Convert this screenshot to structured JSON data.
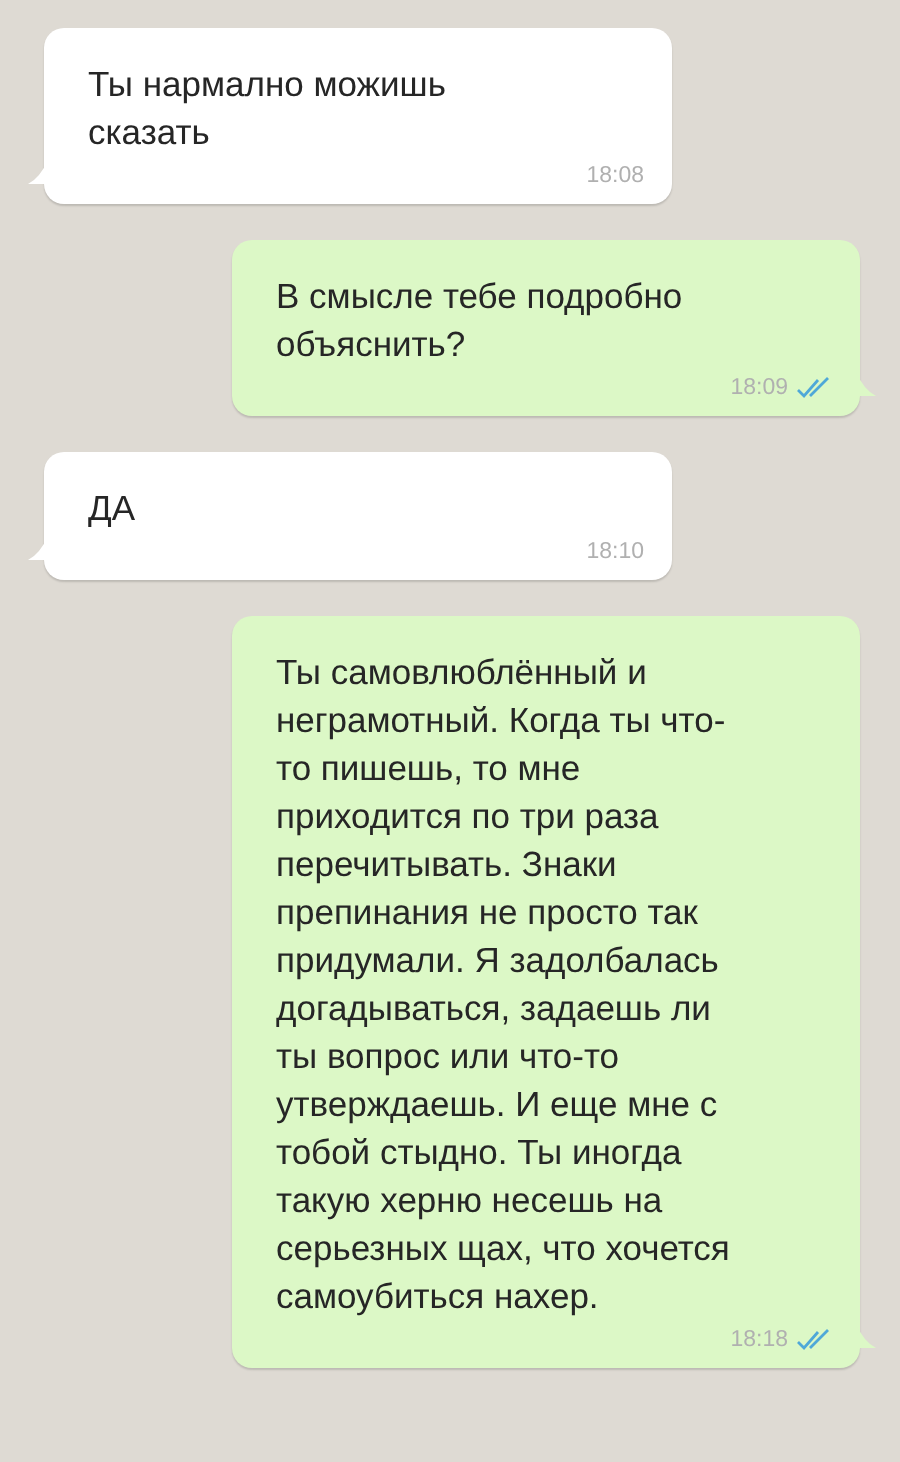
{
  "messages": [
    {
      "outgoing": false,
      "text": "Ты нармално можишь сказать",
      "time": "18:08"
    },
    {
      "outgoing": true,
      "text": "В смысле тебе подробно объяснить?",
      "time": "18:09",
      "read": true
    },
    {
      "outgoing": false,
      "text": "ДА",
      "time": "18:10"
    },
    {
      "outgoing": true,
      "text": "Ты самовлюблённый и неграмотный. Когда ты что-то пишешь, то мне приходится по три раза перечитывать. Знаки препинания не просто так придумали. Я задолбалась догадываться, задаешь ли ты вопрос или что-то утверждаешь. И еще мне с тобой стыдно. Ты иногда такую херню несешь на серьезных щах, что хочется самоубиться нахер.",
      "time": "18:18",
      "read": true
    }
  ]
}
